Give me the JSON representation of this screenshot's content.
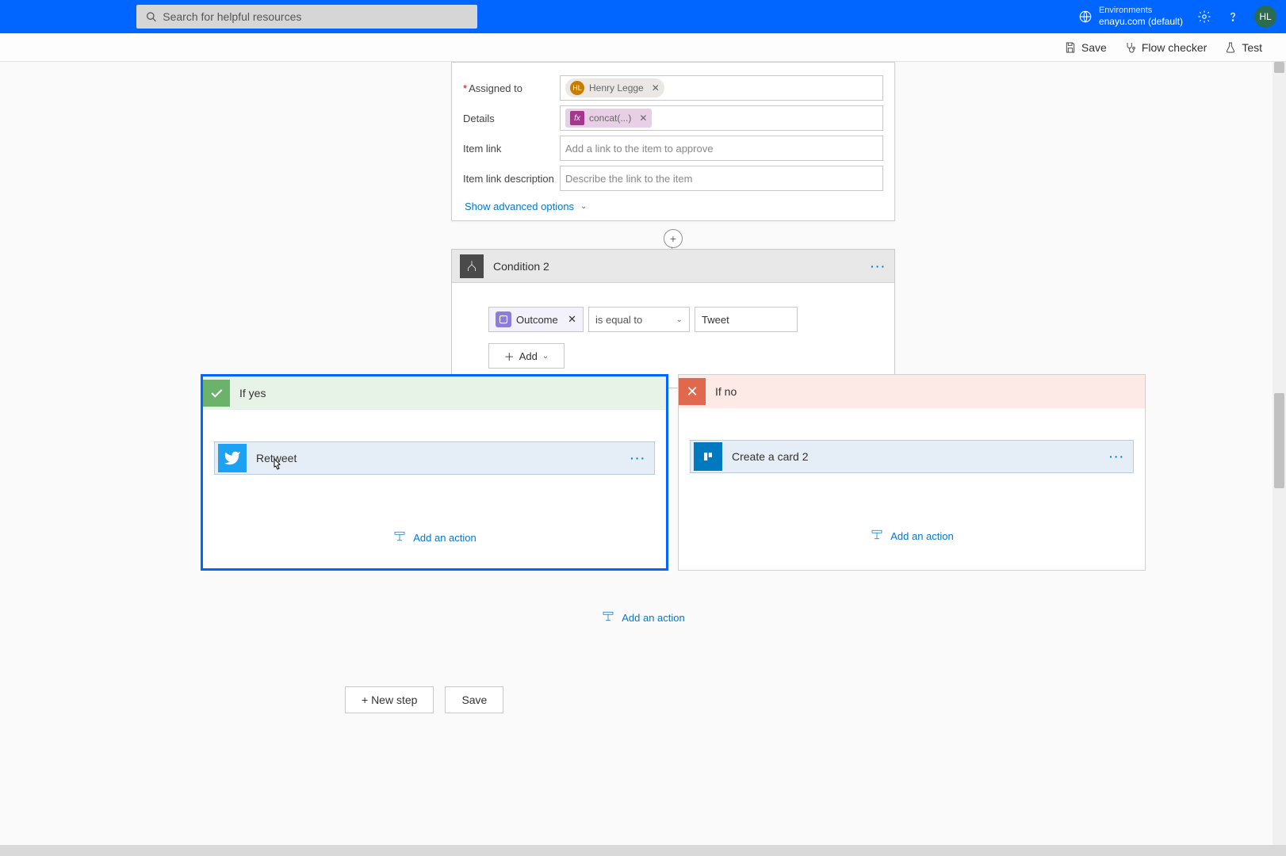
{
  "topbar": {
    "search_placeholder": "Search for helpful resources",
    "env_label": "Environments",
    "env_value": "enayu.com (default)",
    "avatar_initials": "HL"
  },
  "cmdbar": {
    "save": "Save",
    "flow_checker": "Flow checker",
    "test": "Test"
  },
  "approval": {
    "assigned_to_label": "Assigned to",
    "assigned_to_person": "Henry Legge",
    "assigned_to_initials": "HL",
    "details_label": "Details",
    "details_fx": "concat(...)",
    "item_link_label": "Item link",
    "item_link_placeholder": "Add a link to the item to approve",
    "item_link_desc_label": "Item link description",
    "item_link_desc_placeholder": "Describe the link to the item",
    "show_advanced": "Show advanced options"
  },
  "condition": {
    "title": "Condition 2",
    "operand_token": "Outcome",
    "operator": "is equal to",
    "value": "Tweet",
    "add": "Add"
  },
  "branches": {
    "yes_label": "If yes",
    "no_label": "If no",
    "yes_action": "Retweet",
    "no_action": "Create a card 2",
    "add_action": "Add an action"
  },
  "footer": {
    "new_step": "+ New step",
    "save": "Save"
  }
}
